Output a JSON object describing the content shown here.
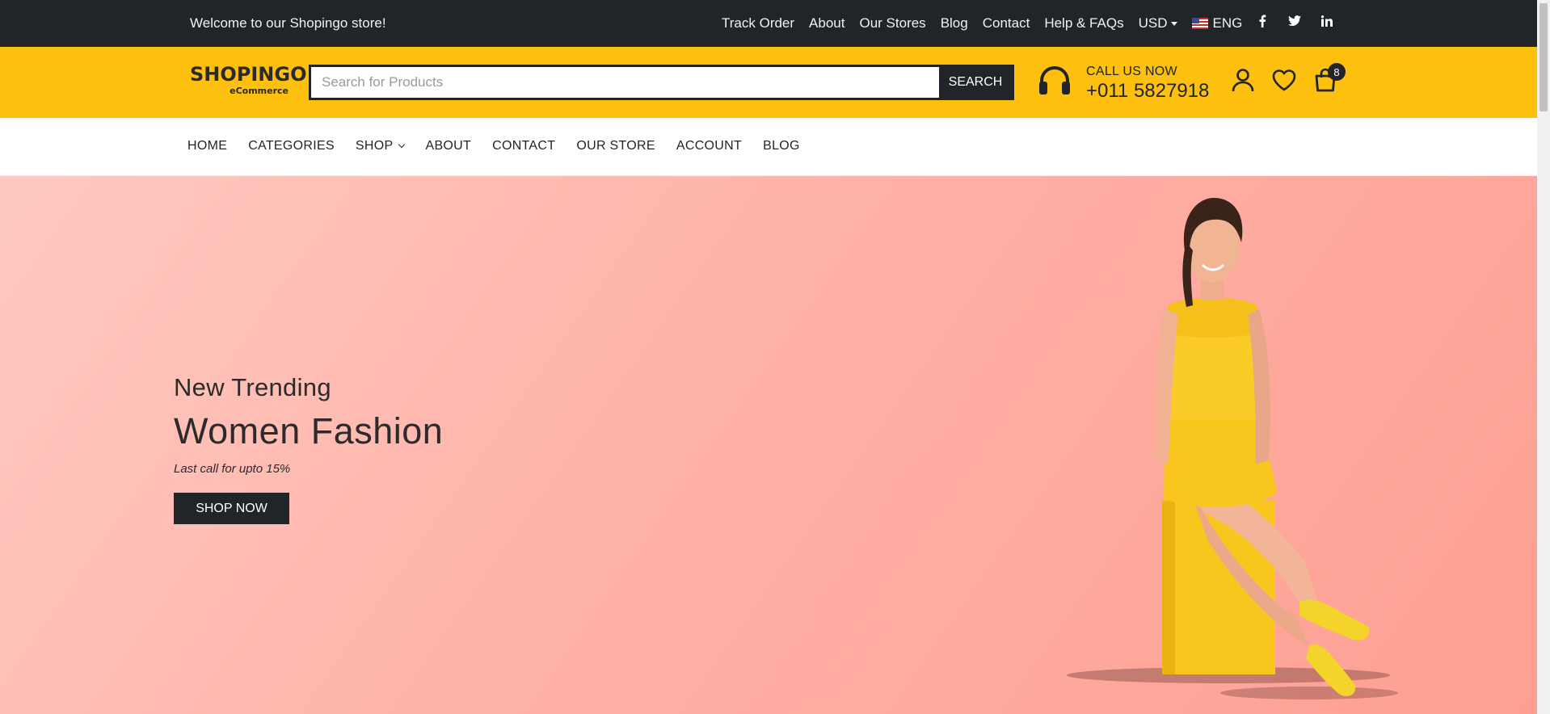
{
  "topbar": {
    "welcome": "Welcome to our Shopingo store!",
    "links": [
      "Track Order",
      "About",
      "Our Stores",
      "Blog",
      "Contact",
      "Help & FAQs"
    ],
    "currency": "USD",
    "language": "ENG",
    "social": [
      "facebook-icon",
      "twitter-icon",
      "linkedin-icon"
    ]
  },
  "header": {
    "logo_main": "SHOPINGO",
    "logo_sub": "eCommerce",
    "search_placeholder": "Search for Products",
    "search_button": "SEARCH",
    "call_label": "CALL US NOW",
    "call_number": "+011 5827918",
    "cart_count": "8",
    "icons": [
      "headset-icon",
      "user-icon",
      "heart-icon",
      "cart-icon"
    ]
  },
  "nav": {
    "items": [
      "HOME",
      "CATEGORIES",
      "SHOP",
      "ABOUT",
      "CONTACT",
      "OUR STORE",
      "ACCOUNT",
      "BLOG"
    ]
  },
  "hero": {
    "subtitle": "New Trending",
    "title": "Women Fashion",
    "offer": "Last call for upto 15%",
    "button": "SHOP NOW"
  },
  "colors": {
    "topbar_bg": "#212529",
    "header_bg": "#fec00f",
    "hero_gradient_start": "#ffc9c1",
    "hero_gradient_end": "#fe9f92",
    "dark": "#212529"
  }
}
